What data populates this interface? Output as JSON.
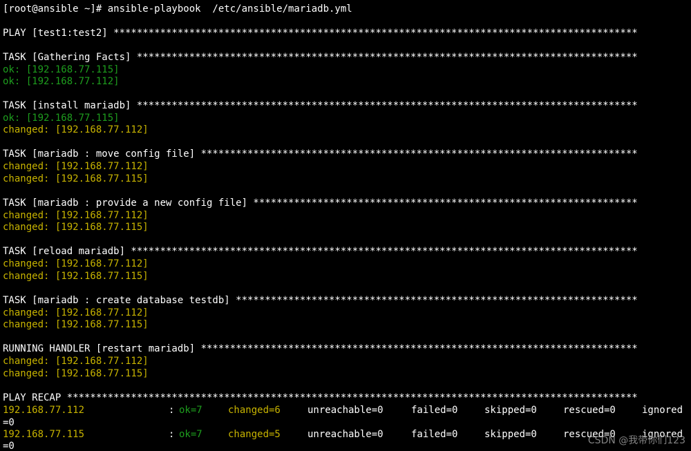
{
  "colors": {
    "background": "#000000",
    "default_text": "#ffffff",
    "ok": "#1e9e1e",
    "changed": "#c8b400",
    "watermark": "#9a9a9a"
  },
  "prompt": {
    "text": "[root@ansible ~]# ansible-playbook  /etc/ansible/mariadb.yml"
  },
  "play": {
    "header": "PLAY [test1:test2] ******************************************************************************************"
  },
  "tasks": [
    {
      "header": "TASK [Gathering Facts] **************************************************************************************",
      "results": [
        {
          "text": "ok: [192.168.77.115]",
          "status": "ok"
        },
        {
          "text": "ok: [192.168.77.112]",
          "status": "ok"
        }
      ]
    },
    {
      "header": "TASK [install mariadb] **************************************************************************************",
      "results": [
        {
          "text": "ok: [192.168.77.115]",
          "status": "ok"
        },
        {
          "text": "changed: [192.168.77.112]",
          "status": "changed"
        }
      ]
    },
    {
      "header": "TASK [mariadb : move config file] ***************************************************************************",
      "results": [
        {
          "text": "changed: [192.168.77.112]",
          "status": "changed"
        },
        {
          "text": "changed: [192.168.77.115]",
          "status": "changed"
        }
      ]
    },
    {
      "header": "TASK [mariadb : provide a new config file] ******************************************************************",
      "results": [
        {
          "text": "changed: [192.168.77.112]",
          "status": "changed"
        },
        {
          "text": "changed: [192.168.77.115]",
          "status": "changed"
        }
      ]
    },
    {
      "header": "TASK [reload mariadb] ***************************************************************************************",
      "results": [
        {
          "text": "changed: [192.168.77.112]",
          "status": "changed"
        },
        {
          "text": "changed: [192.168.77.115]",
          "status": "changed"
        }
      ]
    },
    {
      "header": "TASK [mariadb : create database testdb] *********************************************************************",
      "results": [
        {
          "text": "changed: [192.168.77.112]",
          "status": "changed"
        },
        {
          "text": "changed: [192.168.77.115]",
          "status": "changed"
        }
      ]
    },
    {
      "header": "RUNNING HANDLER [restart mariadb] ***************************************************************************",
      "results": [
        {
          "text": "changed: [192.168.77.112]",
          "status": "changed"
        },
        {
          "text": "changed: [192.168.77.115]",
          "status": "changed"
        }
      ]
    }
  ],
  "recap": {
    "header": "PLAY RECAP **************************************************************************************************",
    "rows": [
      {
        "host": "192.168.77.112",
        "sep": ":",
        "ok": "ok=7",
        "changed": "changed=6",
        "unreachable": "unreachable=0",
        "failed": "failed=0",
        "skipped": "skipped=0",
        "rescued": "rescued=0",
        "ignored": "ignored",
        "wrap": "=0"
      },
      {
        "host": "192.168.77.115",
        "sep": ":",
        "ok": "ok=7",
        "changed": "changed=5",
        "unreachable": "unreachable=0",
        "failed": "failed=0",
        "skipped": "skipped=0",
        "rescued": "rescued=0",
        "ignored": "ignored",
        "wrap": "=0"
      }
    ]
  },
  "watermark": "CSDN @我带你们123"
}
